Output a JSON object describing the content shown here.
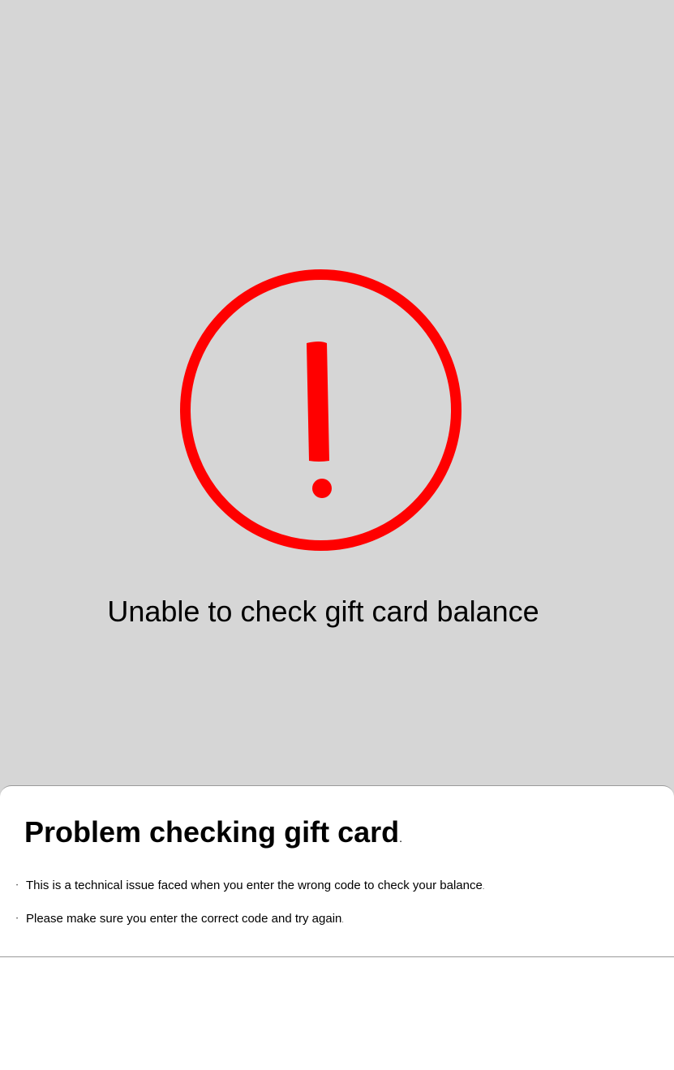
{
  "error_screen": {
    "icon": "exclamation-circle-icon",
    "icon_color": "#ff0000",
    "background_color": "#d6d6d6",
    "message": "Unable to check gift card balance"
  },
  "sheet": {
    "title": "Problem checking gift card",
    "title_suffix": ".",
    "items": [
      {
        "text": "This is a technical issue faced when you enter the wrong code to check your balance",
        "suffix": "."
      },
      {
        "text": "Please make sure you enter the correct code and try again",
        "suffix": "."
      }
    ]
  }
}
